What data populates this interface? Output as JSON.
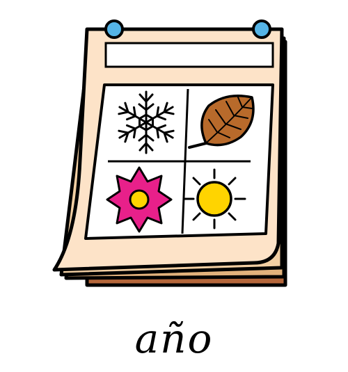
{
  "pictogram": {
    "word": "año",
    "panels": [
      {
        "season": "winter",
        "icon": "snowflake-icon"
      },
      {
        "season": "autumn",
        "icon": "leaf-icon"
      },
      {
        "season": "spring",
        "icon": "flower-icon"
      },
      {
        "season": "summer",
        "icon": "sun-icon"
      }
    ]
  },
  "colors": {
    "page": "#fde3c8",
    "page_back1": "#f2cfa3",
    "page_back2": "#e2b27c",
    "page_back3": "#b5673b",
    "pin": "#55b4e6",
    "leaf": "#b86a2b",
    "flower": "#e8208a",
    "flower_center": "#ffd400",
    "sun": "#ffd400",
    "outline": "#000000"
  }
}
